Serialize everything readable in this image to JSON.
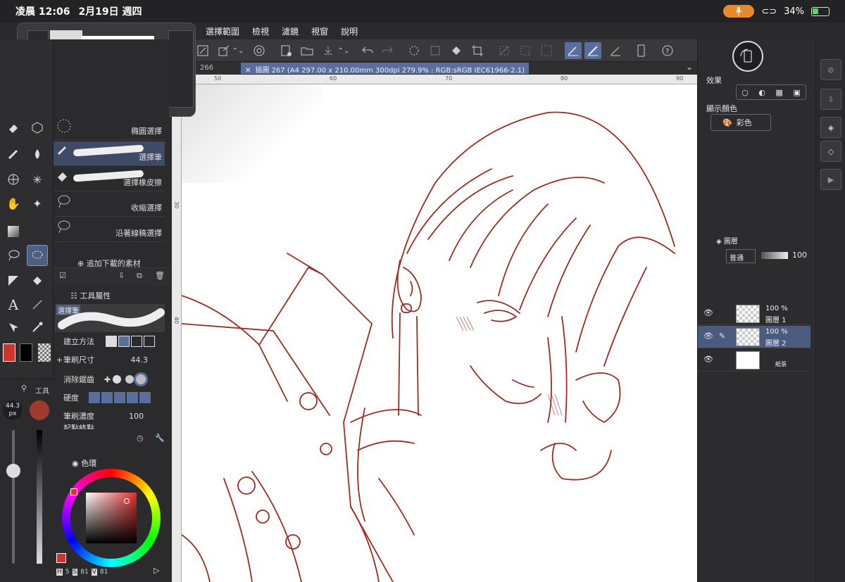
{
  "status_bar": {
    "time": "凌晨 12:06",
    "date": "2月19日 週四",
    "battery": "34%",
    "battery_level": 0.34
  },
  "menu": {
    "items": [
      "選擇範圍",
      "檢視",
      "濾鏡",
      "視窗",
      "說明"
    ]
  },
  "document": {
    "prev_tab": "266",
    "title": "插圖 267 (A4 297.00 x 210.00mm 300dpi 279.9% : RGB:sRGB IEC61966-2.1)",
    "ruler_top": [
      "50",
      "60",
      "70",
      "80",
      "90"
    ],
    "ruler_left": [
      "30",
      "40"
    ]
  },
  "subtools": {
    "items": [
      {
        "label": "橢圓選擇"
      },
      {
        "label": "選擇筆"
      },
      {
        "label": "選擇橡皮擦"
      },
      {
        "label": "收縮選擇"
      },
      {
        "label": "沿著線稿選擇"
      }
    ],
    "add_material": "追加下載的素材"
  },
  "tool_property": {
    "tab_label": "工具屬性",
    "preview_label": "選擇筆",
    "create_method_label": "建立方法",
    "brush_size_label": "筆刷尺寸",
    "brush_size_value": "44.3",
    "antialias_label": "消除鋸齒",
    "hardness_label": "硬度",
    "density_label": "筆刷濃度",
    "density_value": "100",
    "cutoff_label": "起點終點"
  },
  "brush_side": {
    "size_value": "44.3",
    "size_unit": "px",
    "header_label": "工具"
  },
  "color_panel": {
    "tab_label": "色環",
    "main_color": "#d0332c",
    "sub_color": "#000000",
    "values": {
      "h_label": "H",
      "h": "5",
      "s_label": "S",
      "s": "81",
      "v_label": "V",
      "v": "81"
    }
  },
  "right_panel": {
    "effect_label": "效果",
    "display_color_label": "顯示顏色",
    "display_color_value": "彩色",
    "layers_tab": "圖層",
    "blend_mode": "普通",
    "opacity": "100",
    "layers": [
      {
        "pct": "100 %",
        "name": "圖層 1",
        "selected": false
      },
      {
        "pct": "100 %",
        "name": "圖層 2",
        "selected": true
      },
      {
        "pct": "",
        "name": "紙張",
        "selected": false
      }
    ]
  },
  "accent": "#5a6e9e",
  "sketch_color": "#a32a22"
}
